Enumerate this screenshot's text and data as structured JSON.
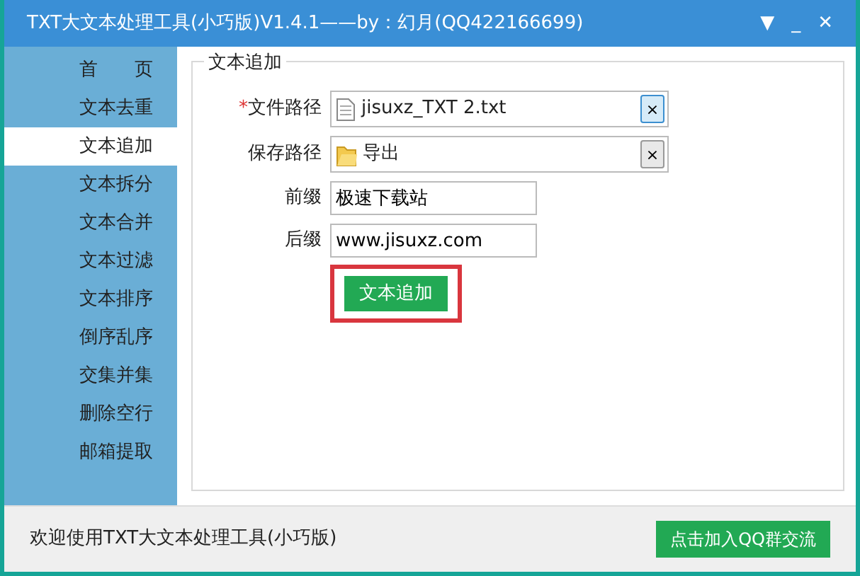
{
  "window": {
    "title": "TXT大文本处理工具(小巧版)V1.4.1——by：幻月(QQ422166699)",
    "menu_glyph": "▼",
    "minimize_glyph": "_",
    "close_glyph": "✕"
  },
  "sidebar": {
    "items": [
      {
        "label": "首　　页",
        "selected": false
      },
      {
        "label": "文本去重",
        "selected": false
      },
      {
        "label": "文本追加",
        "selected": true
      },
      {
        "label": "文本拆分",
        "selected": false
      },
      {
        "label": "文本合并",
        "selected": false
      },
      {
        "label": "文本过滤",
        "selected": false
      },
      {
        "label": "文本排序",
        "selected": false
      },
      {
        "label": "倒序乱序",
        "selected": false
      },
      {
        "label": "交集并集",
        "selected": false
      },
      {
        "label": "删除空行",
        "selected": false
      },
      {
        "label": "邮箱提取",
        "selected": false
      }
    ]
  },
  "panel": {
    "legend": "文本追加",
    "fields": [
      {
        "kind": "file",
        "required": true,
        "required_mark": "*",
        "label": "文件路径",
        "value": "jisuxz_TXT 2.txt",
        "clear": "×",
        "highlighted": true
      },
      {
        "kind": "folder",
        "label": "保存路径",
        "value": "导出",
        "clear": "×",
        "highlighted": false
      },
      {
        "kind": "text",
        "label": "前缀",
        "value": "极速下载站"
      },
      {
        "kind": "text",
        "label": "后缀",
        "value": "www.jisuxz.com"
      }
    ],
    "action": {
      "label": "文本追加",
      "highlighted": true
    }
  },
  "status_bar": {
    "text": "欢迎使用TXT大文本处理工具(小巧版)",
    "button": "点击加入QQ群交流"
  }
}
